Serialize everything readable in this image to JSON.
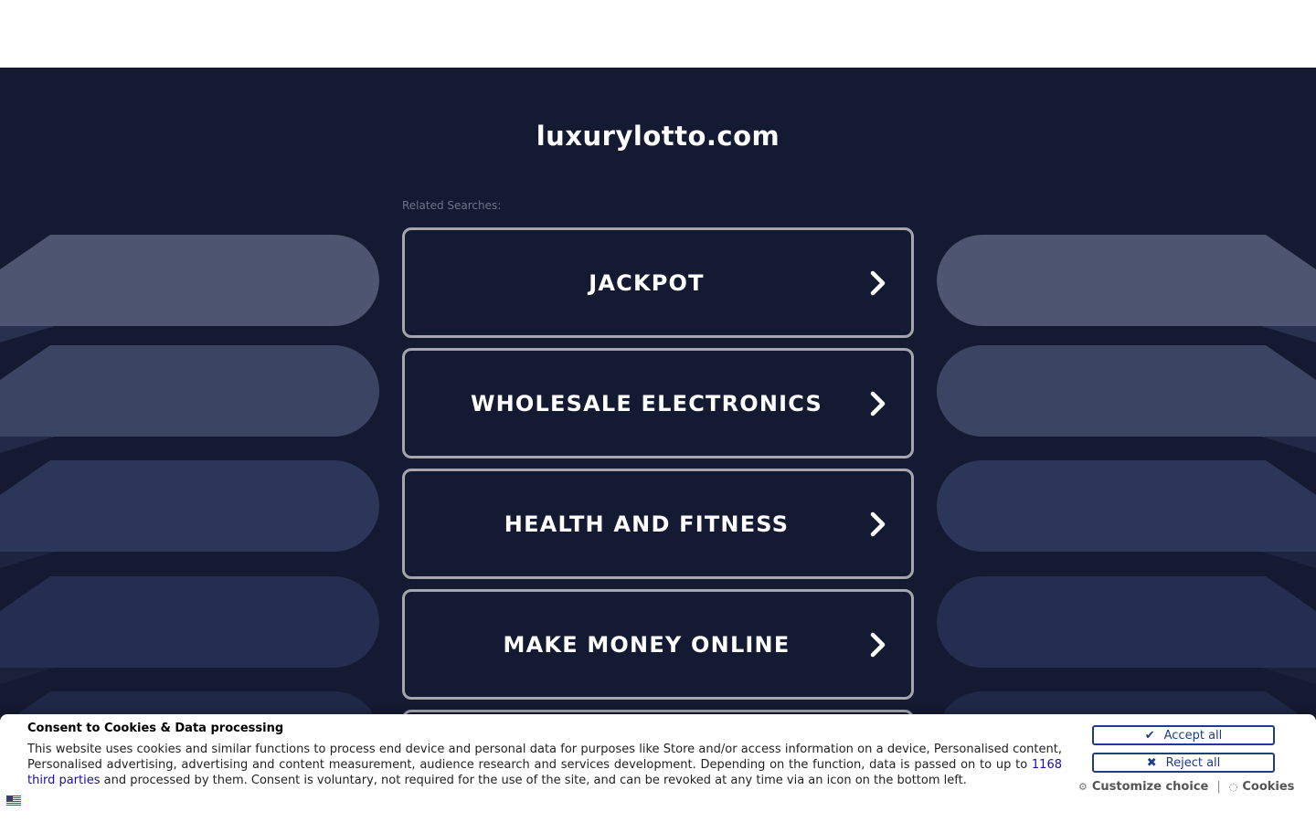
{
  "site": {
    "title": "luxurylotto.com",
    "related_label": "Related Searches:"
  },
  "searches": [
    {
      "label": "JACKPOT"
    },
    {
      "label": "WHOLESALE ELECTRONICS"
    },
    {
      "label": "HEALTH AND FITNESS"
    },
    {
      "label": "MAKE MONEY ONLINE"
    }
  ],
  "consent": {
    "title": "Consent to Cookies & Data processing",
    "text_before": "This website uses cookies and similar functions to process end device and personal data for purposes like Store and/or access information on a device, Personalised content, Personalised advertising, advertising and content measurement, audience research and services development. Depending on the function, data is passed on to up to ",
    "link_text": "1168 third parties",
    "text_after": " and processed by them. Consent is voluntary, not required for the use of the site, and can be revoked at any time via an icon on the bottom left.",
    "accept_label": "Accept all",
    "reject_label": "Reject all",
    "customize_label": "Customize choice",
    "cookies_label": "Cookies",
    "separator": "|"
  },
  "colors": {
    "background": "#141a31",
    "box_border": "#a5a6ad",
    "button_accent": "#1f3c88"
  }
}
